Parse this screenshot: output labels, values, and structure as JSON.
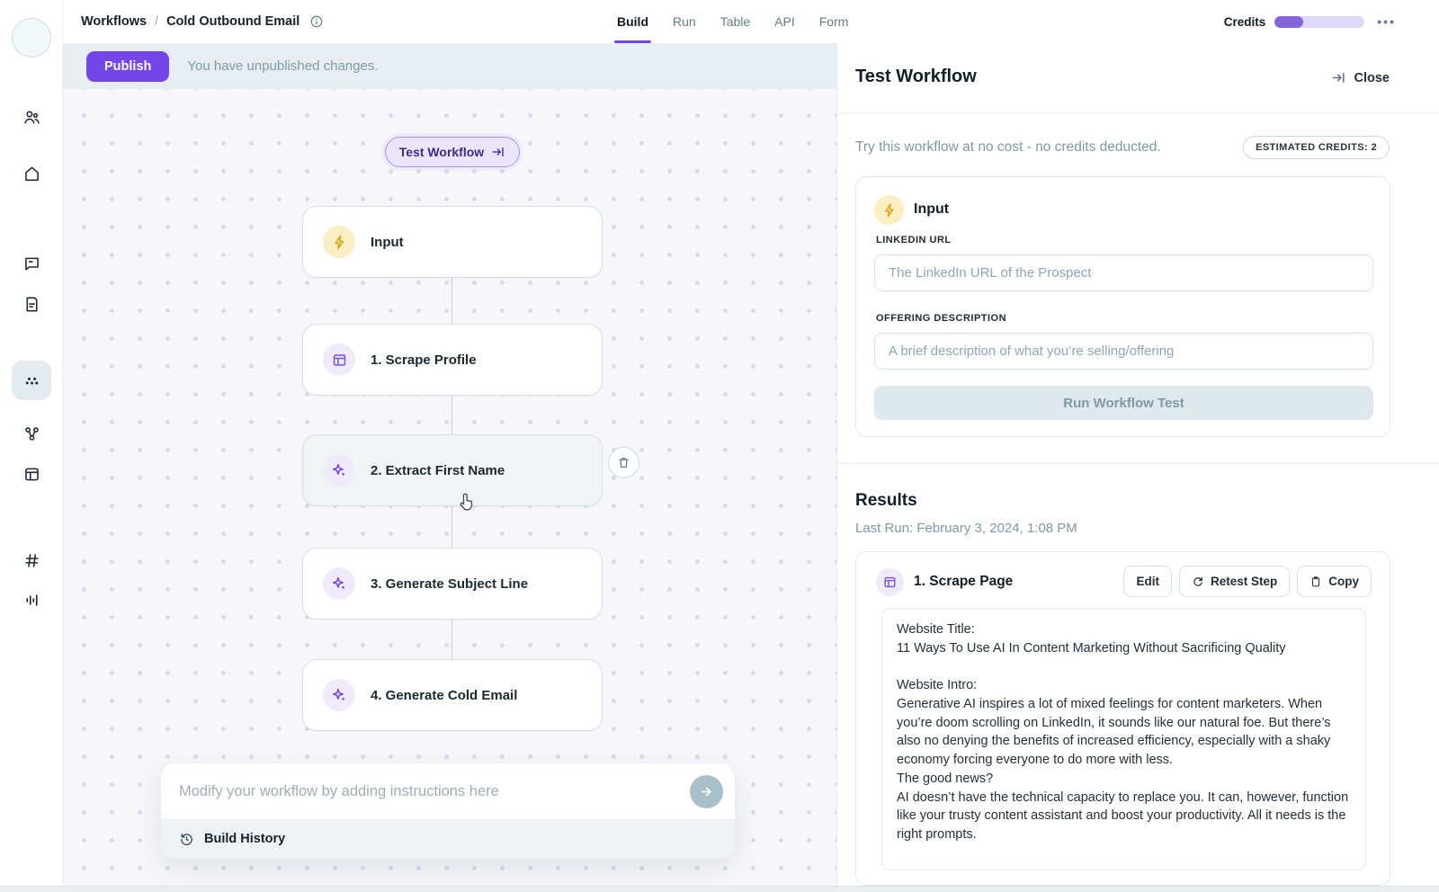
{
  "topbar": {
    "breadcrumb": {
      "root": "Workflows",
      "separator": "/",
      "current": "Cold Outbound Email"
    },
    "tabs": {
      "build": "Build",
      "run": "Run",
      "table": "Table",
      "api": "API",
      "form": "Form"
    },
    "active_tab": "Build",
    "credits_label": "Credits",
    "credits_percent": 32,
    "overflow_menu": "•••"
  },
  "banner": {
    "publish_button": "Publish",
    "message": "You have unpublished changes."
  },
  "sidebar": {
    "icons": [
      "user-avatar",
      "people",
      "home",
      "chat-bubble",
      "document",
      "dots-grid",
      "branch",
      "table-layout",
      "hash",
      "waveform"
    ],
    "active_icon": "dots-grid"
  },
  "canvas": {
    "test_workflow_button": "Test Workflow",
    "nodes": [
      {
        "label": "Input",
        "icon": "lightning-bolt"
      },
      {
        "label": "1. Scrape Profile",
        "icon": "browser-window"
      },
      {
        "label": "2. Extract First Name",
        "icon": "ai-sparkle"
      },
      {
        "label": "3. Generate Subject Line",
        "icon": "ai-sparkle"
      },
      {
        "label": "4. Generate Cold Email",
        "icon": "ai-sparkle"
      }
    ],
    "instruction_placeholder": "Modify your workflow by adding instructions here",
    "build_history_label": "Build History"
  },
  "panel": {
    "title": "Test Workflow",
    "close_label": "Close",
    "subtitle": "Try this workflow at no cost - no credits deducted.",
    "estimated_credits_badge": "ESTIMATED CREDITS: 2",
    "input_card": {
      "title": "Input",
      "linkedin_label": "LINKEDIN URL",
      "linkedin_placeholder": "The LinkedIn URL of the Prospect",
      "offering_label": "OFFERING DESCRIPTION",
      "offering_placeholder": "A brief description of what you’re selling/offering",
      "run_button": "Run Workflow Test"
    },
    "results": {
      "heading": "Results",
      "last_run": "Last Run: February 3, 2024, 1:08 PM",
      "step": {
        "title": "1. Scrape Page",
        "edit_button": "Edit",
        "retest_button": "Retest Step",
        "copy_button": "Copy",
        "output": "Website Title:\n11 Ways To Use AI In Content Marketing Without Sacrificing Quality\n\nWebsite Intro:\nGenerative AI inspires a lot of mixed feelings for content marketers. When you’re doom scrolling on LinkedIn, it sounds like our natural foe. But there’s also no denying the benefits of increased efficiency, especially with a shaky economy forcing everyone to do more with less.\nThe good news?\nAI doesn’t have the technical capacity to replace you. It can, however, function like your trusty content assistant and boost your productivity. All it needs is the right prompts."
      }
    }
  },
  "colors": {
    "accent_purple": "#7445e8",
    "credits_fill": "#8566d9",
    "muted_blue_gray": "#7d99a8",
    "banner_bg": "#e7edf0"
  }
}
